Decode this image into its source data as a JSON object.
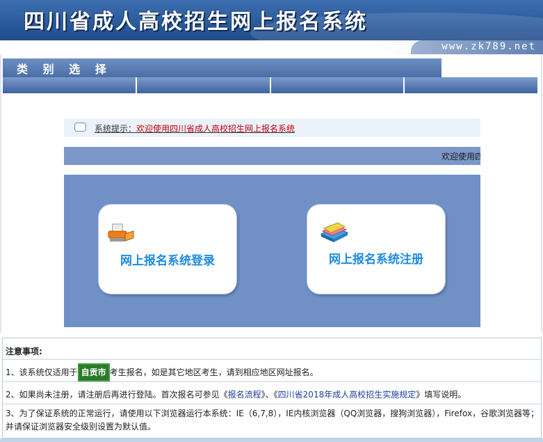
{
  "header": {
    "title": "四川省成人高校招生网上报名系统",
    "url": "www.zk789.net"
  },
  "category": {
    "label": "类 别 选 择",
    "tabs": [
      "",
      "",
      "",
      ""
    ]
  },
  "notice": {
    "prefix": "系统提示：",
    "message": "欢迎使用四川省成人高校招生网上报名系统"
  },
  "marquee": {
    "text": "欢迎使用四"
  },
  "cards": {
    "login": {
      "label": "网上报名系统登录",
      "icon": "printer-icon"
    },
    "register": {
      "label": "网上报名系统注册",
      "icon": "books-icon"
    }
  },
  "notes": {
    "heading": "注意事项:",
    "item1": {
      "prefix": "1、该系统仅适用于",
      "highlight": "自贡市",
      "suffix": "考生报名，如是其它地区考生，请到相应地区网址报名。"
    },
    "item2": {
      "prefix": "2、如果尚未注册，请注册后再进行登陆。首次报名可参见《",
      "link1": "报名流程",
      "mid": "》、《",
      "link2": "四川省2018年成人高校招生实施规定",
      "suffix": "》填写说明。"
    },
    "item3": {
      "line1": "3、为了保证系统的正常运行，请使用以下浏览器运行本系统：IE（6,7,8），IE内核浏览器（QQ浏览器，搜狗浏览器），Firefox，谷歌浏览器等；",
      "line2": "并请保证浏览器安全级别设置为默认值。"
    }
  },
  "colors": {
    "banner": "#2b5b9d",
    "panel": "#7090c6",
    "card_text": "#1e8be0",
    "notice_text": "#c0000a",
    "highlight": "#2a7a2a"
  }
}
